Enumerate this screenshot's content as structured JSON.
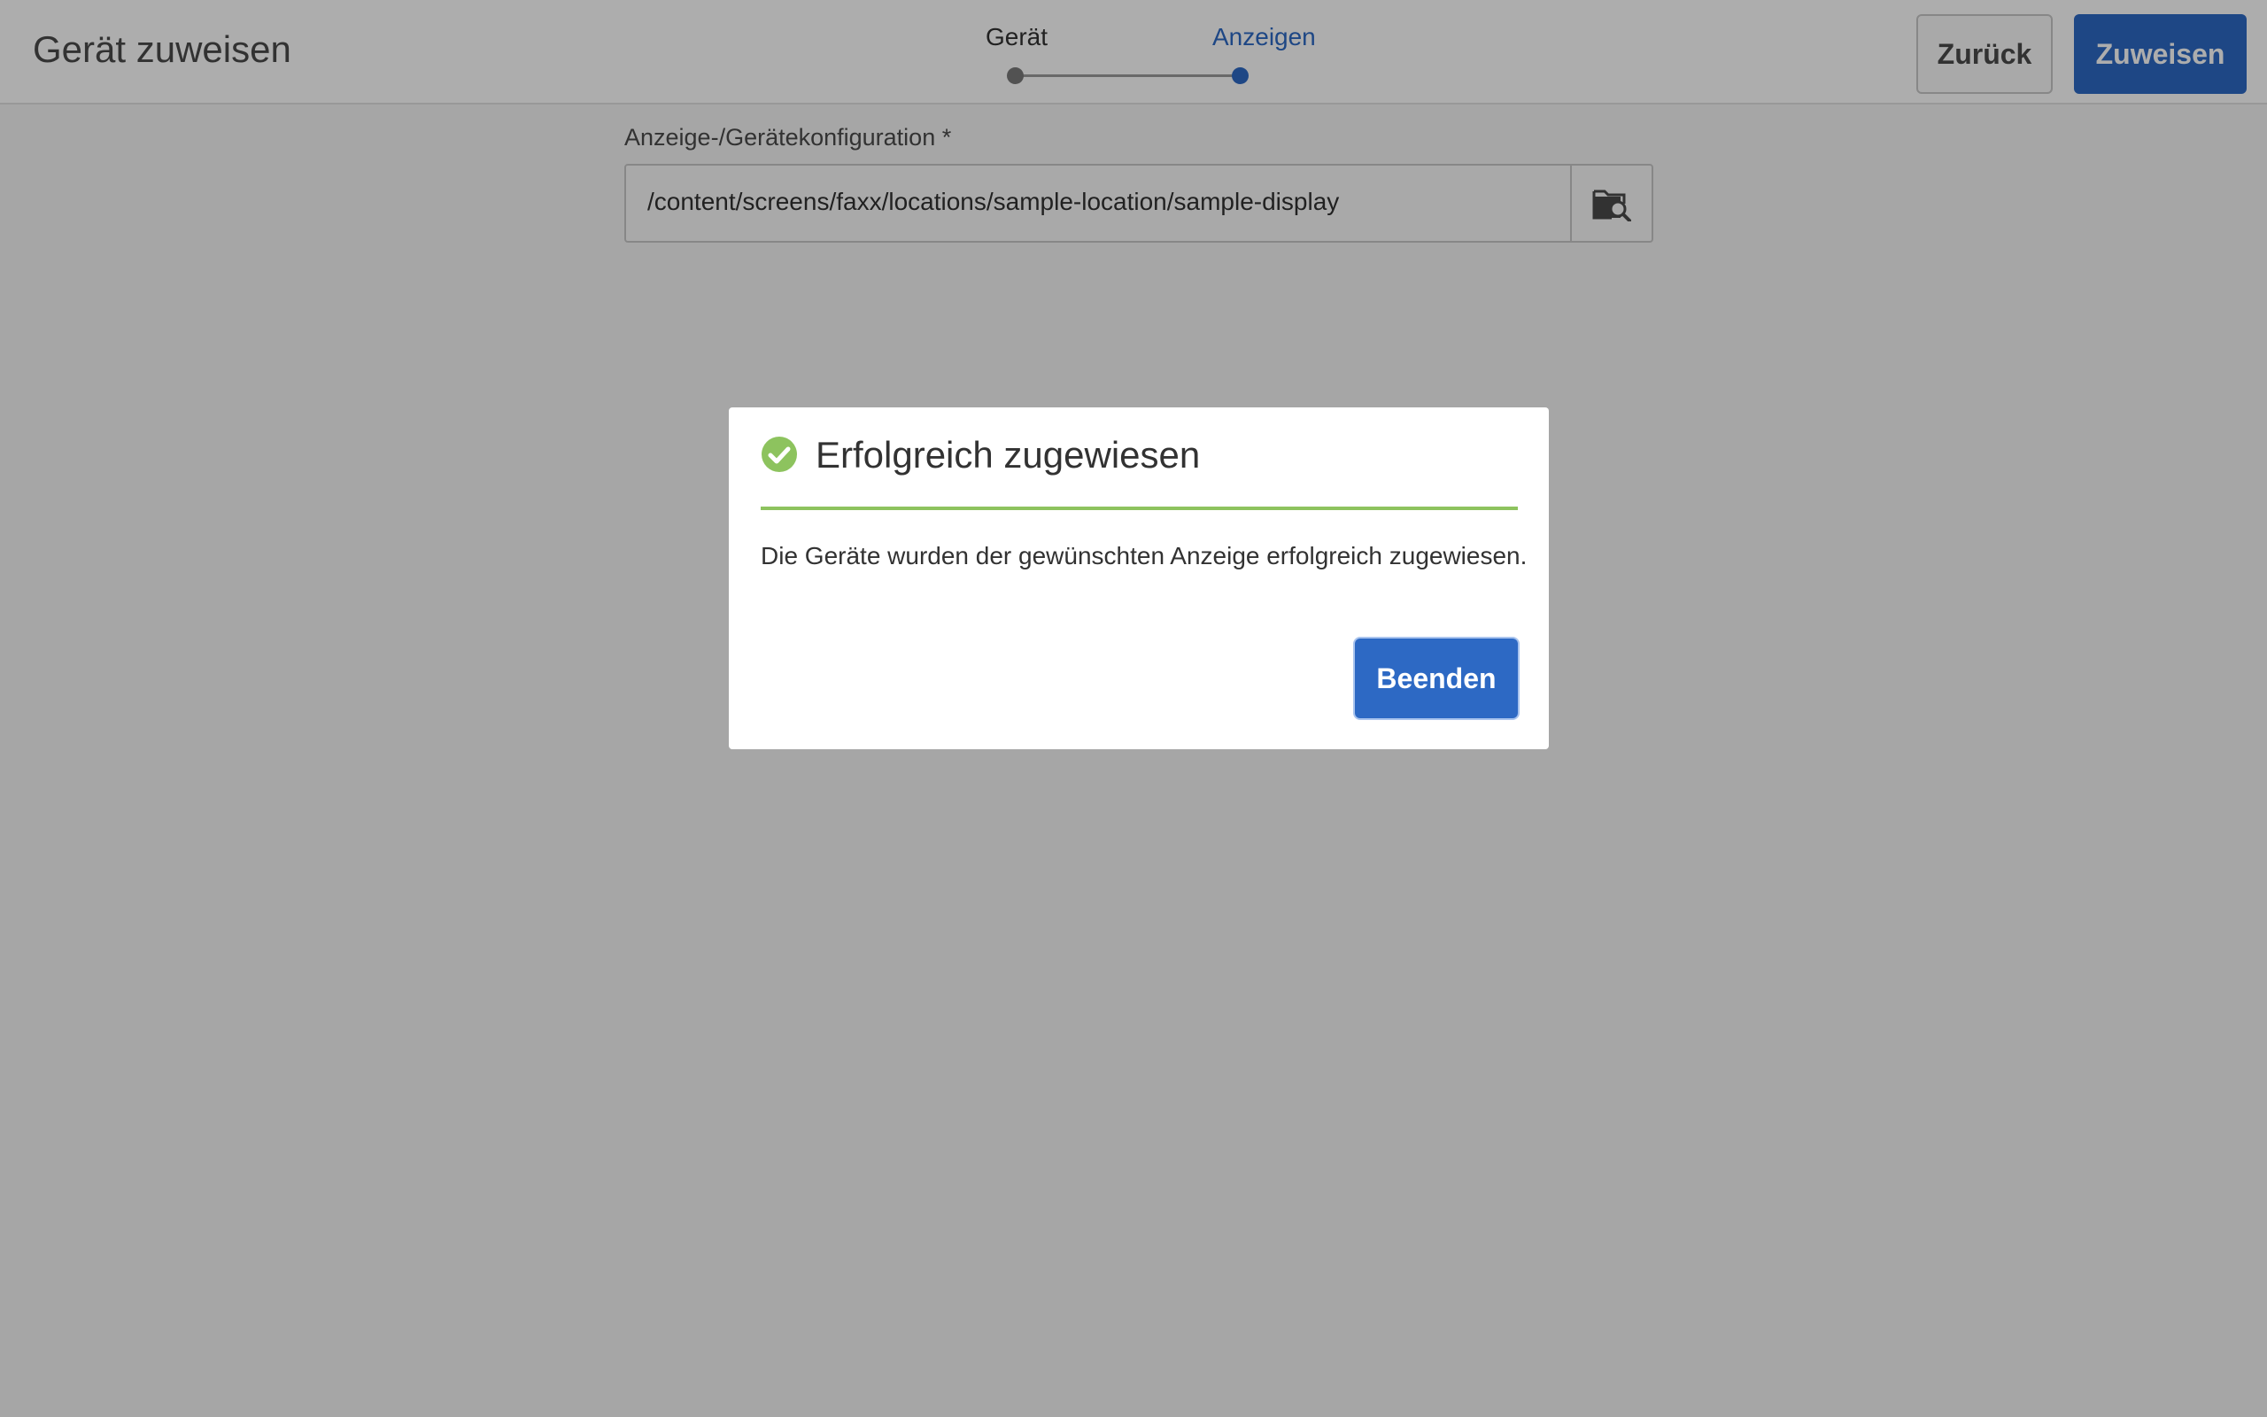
{
  "header": {
    "title": "Gerät zuweisen",
    "steps": [
      {
        "label": "Gerät",
        "state": "completed"
      },
      {
        "label": "Anzeigen",
        "state": "current"
      }
    ],
    "back_label": "Zurück",
    "assign_label": "Zuweisen"
  },
  "form": {
    "label": "Anzeige-/Gerätekonfiguration *",
    "value": "/content/screens/faxx/locations/sample-location/sample-display",
    "browse_icon": "folder-search-icon"
  },
  "dialog": {
    "icon": "check-circle-icon",
    "title": "Erfolgreich zugewiesen",
    "message": "Die Geräte wurden der gewünschten Anzeige erfolgreich zugewiesen.",
    "finish_label": "Beenden"
  },
  "colors": {
    "accent": "#2d69c4",
    "success": "#8dc35e",
    "overlay": "rgba(0,0,0,0.32)"
  }
}
